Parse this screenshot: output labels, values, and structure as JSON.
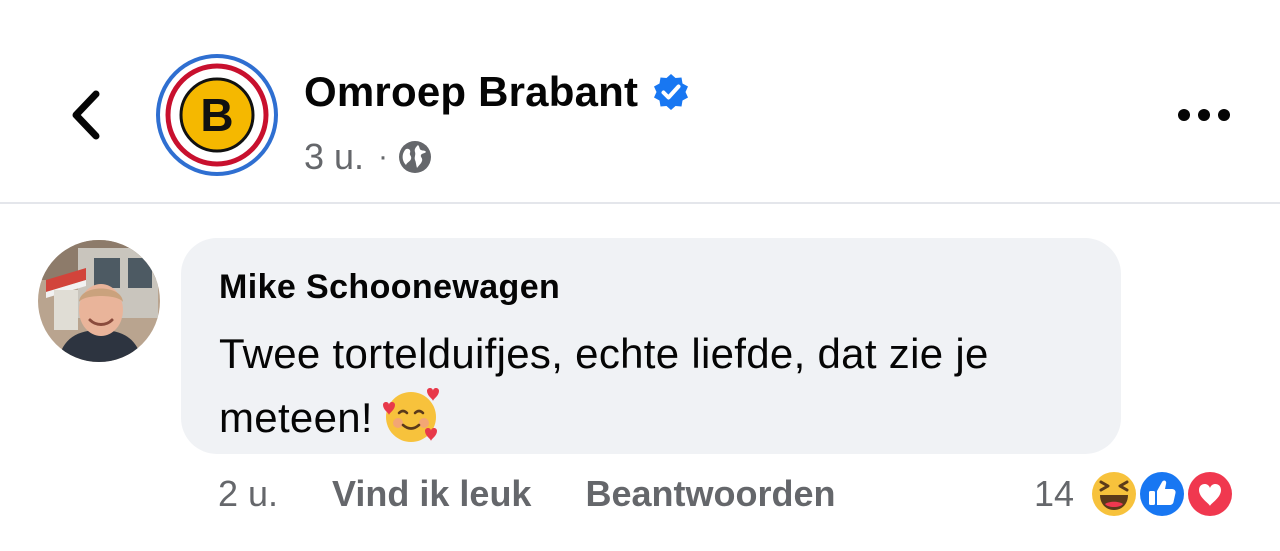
{
  "header": {
    "back_icon": "chevron-left-icon",
    "page_name": "Omroep Brabant",
    "verified_icon": "verified-badge-icon",
    "time": "3 u.",
    "separator": "·",
    "audience_icon": "globe-icon",
    "more_icon": "more-horizontal-icon",
    "logo_letter": "B"
  },
  "comment": {
    "author": "Mike Schoonewagen",
    "text": "Twee tortelduifjes, echte liefde, dat zie je meteen!",
    "emoji": "smiling-face-with-hearts",
    "time": "2 u.",
    "like_label": "Vind ik leuk",
    "reply_label": "Beantwoorden",
    "reaction_count": "14",
    "reactions": [
      "haha-icon",
      "like-icon",
      "love-icon"
    ]
  },
  "colors": {
    "text": "#050505",
    "secondary": "#65676b",
    "bubble": "#f0f2f5",
    "verified": "#1877f2",
    "logo_yellow": "#f5b800",
    "logo_red": "#c8102e",
    "logo_blue": "#2f6fd1"
  }
}
